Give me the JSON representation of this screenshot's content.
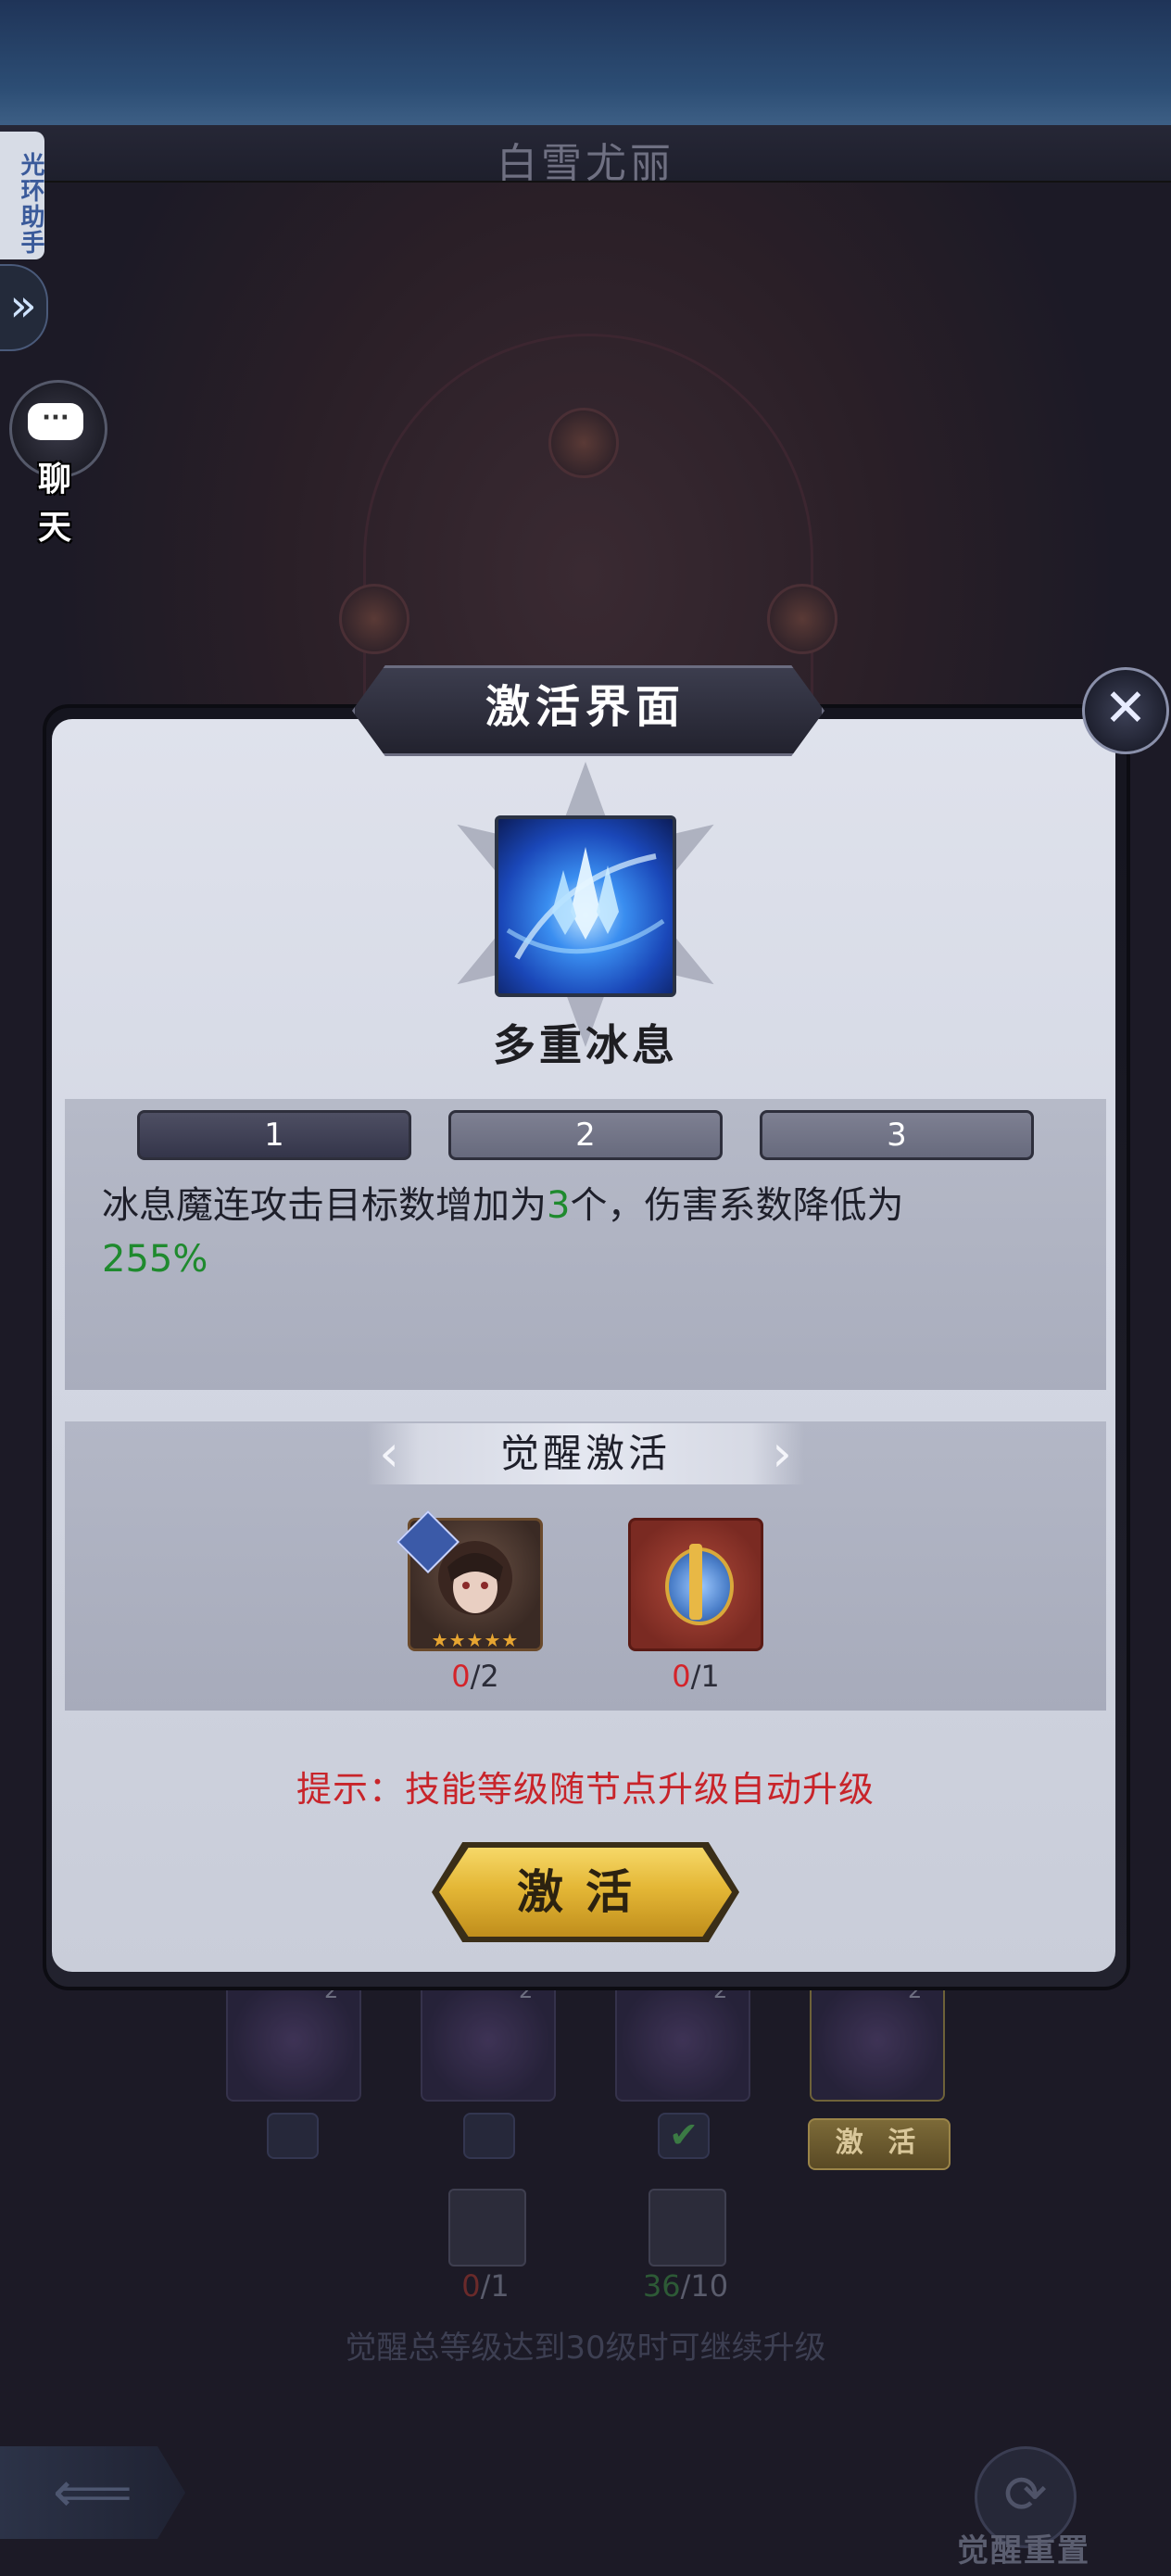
{
  "hero": {
    "name": "白雪尤丽"
  },
  "side": {
    "assist_label": "光环助手",
    "chat_label": "聊 天",
    "chat_bubble": "···"
  },
  "dialog": {
    "title": "激活界面",
    "close_glyph": "✕",
    "skill_name": "多重冰息",
    "level_tabs": [
      "1",
      "2",
      "3"
    ],
    "active_level": "1",
    "description": {
      "part1": "冰息魔连攻击目标数增加为",
      "value1": "3",
      "part2": "个，伤害系数降低为",
      "value2": "255%"
    },
    "awaken": {
      "title": "觉醒激活",
      "materials": [
        {
          "have": "0",
          "need": "/2"
        },
        {
          "have": "0",
          "need": "/1"
        }
      ]
    },
    "hint": "提示：技能等级随节点升级自动升级",
    "activate_label": "激活"
  },
  "background": {
    "skill_levels": [
      "2",
      "2",
      "2",
      "2"
    ],
    "activate_label": "激 活",
    "materials": [
      {
        "have": "0",
        "need": "/1"
      },
      {
        "have": "36",
        "need": "/10"
      }
    ],
    "hint": "觉醒总等级达到30级时可继续升级",
    "reset_label": "觉醒重置"
  },
  "colors": {
    "highlight_green": "#1f8a2e",
    "hint_red": "#c8242a",
    "button_gold": "#e4b736"
  }
}
